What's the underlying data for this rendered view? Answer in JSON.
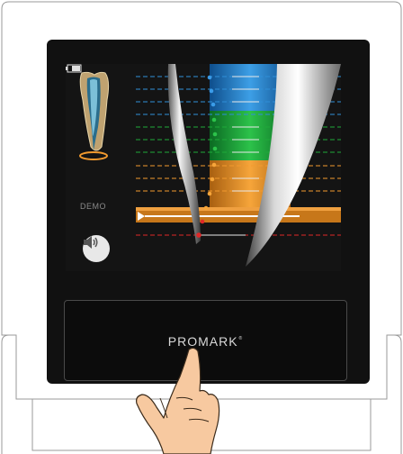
{
  "screen": {
    "demo_label": "DEMO"
  },
  "panel": {
    "brand": "PROMARK",
    "brand_mark": "®"
  },
  "icons": {
    "tooth": "tooth-icon",
    "sound": "speaker-icon",
    "battery": "battery-icon",
    "file": "endodontic-file-graphic",
    "hand": "pointing-hand-icon"
  },
  "colors": {
    "zone_blue": "#2f8fd8",
    "zone_green": "#1faa3a",
    "zone_orange": "#f29a2e",
    "zone_red": "#e02828",
    "dash_white": "#d0d0d0"
  }
}
